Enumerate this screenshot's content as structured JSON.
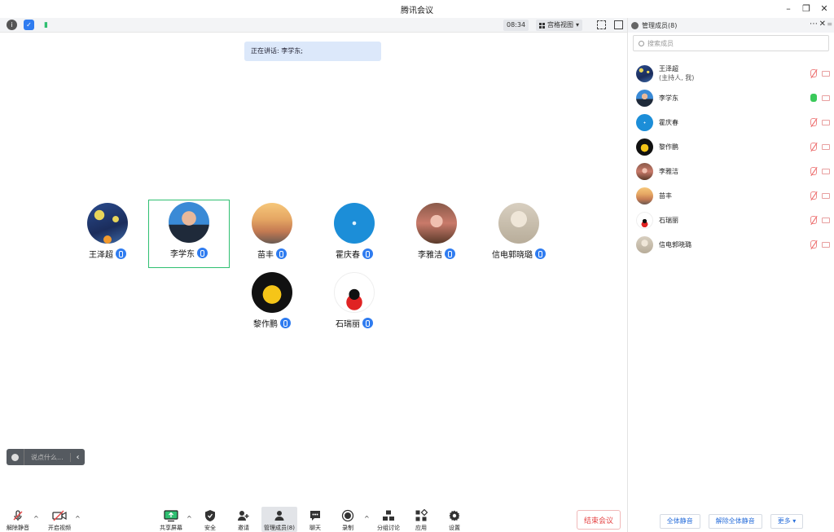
{
  "window": {
    "title": "腾讯会议"
  },
  "topbar": {
    "clock": "08:34",
    "view_label": "宫格视图"
  },
  "speaking": "正在讲话: 李学东;",
  "tiles": [
    {
      "name": "王泽超",
      "avatar": "av-starry"
    },
    {
      "name": "李学东",
      "avatar": "av-man"
    },
    {
      "name": "苗丰",
      "avatar": "av-sunset"
    },
    {
      "name": "霍庆春",
      "avatar": "av-blue"
    },
    {
      "name": "李雅洁",
      "avatar": "av-girl"
    },
    {
      "name": "信电郭晓璐",
      "avatar": "av-sketch"
    },
    {
      "name": "黎作鹏",
      "avatar": "av-hawk"
    },
    {
      "name": "石瑞丽",
      "avatar": "av-minnie"
    }
  ],
  "chat": {
    "placeholder": "说点什么..."
  },
  "toolbar": {
    "mute": "解除静音",
    "video": "开启视频",
    "share": "共享屏幕",
    "security": "安全",
    "invite": "邀请",
    "members": "管理成员(8)",
    "chat": "聊天",
    "record": "录制",
    "breakout": "分组讨论",
    "apps": "应用",
    "settings": "设置",
    "end": "结束会议"
  },
  "panel": {
    "title": "管理成员(8)",
    "search_placeholder": "搜索成员",
    "members": [
      {
        "name": "王泽超",
        "sub": "(主持人, 我)"
      },
      {
        "name": "李学东"
      },
      {
        "name": "霍庆春"
      },
      {
        "name": "黎作鹏"
      },
      {
        "name": "李雅洁"
      },
      {
        "name": "苗丰"
      },
      {
        "name": "石瑞丽"
      },
      {
        "name": "信电郭晓璐"
      }
    ],
    "mute_all": "全体静音",
    "unmute_all": "解除全体静音",
    "more": "更多"
  },
  "colors": {
    "accent": "#2f7cf0",
    "active_border": "#2fbf71",
    "end": "#e54545"
  }
}
